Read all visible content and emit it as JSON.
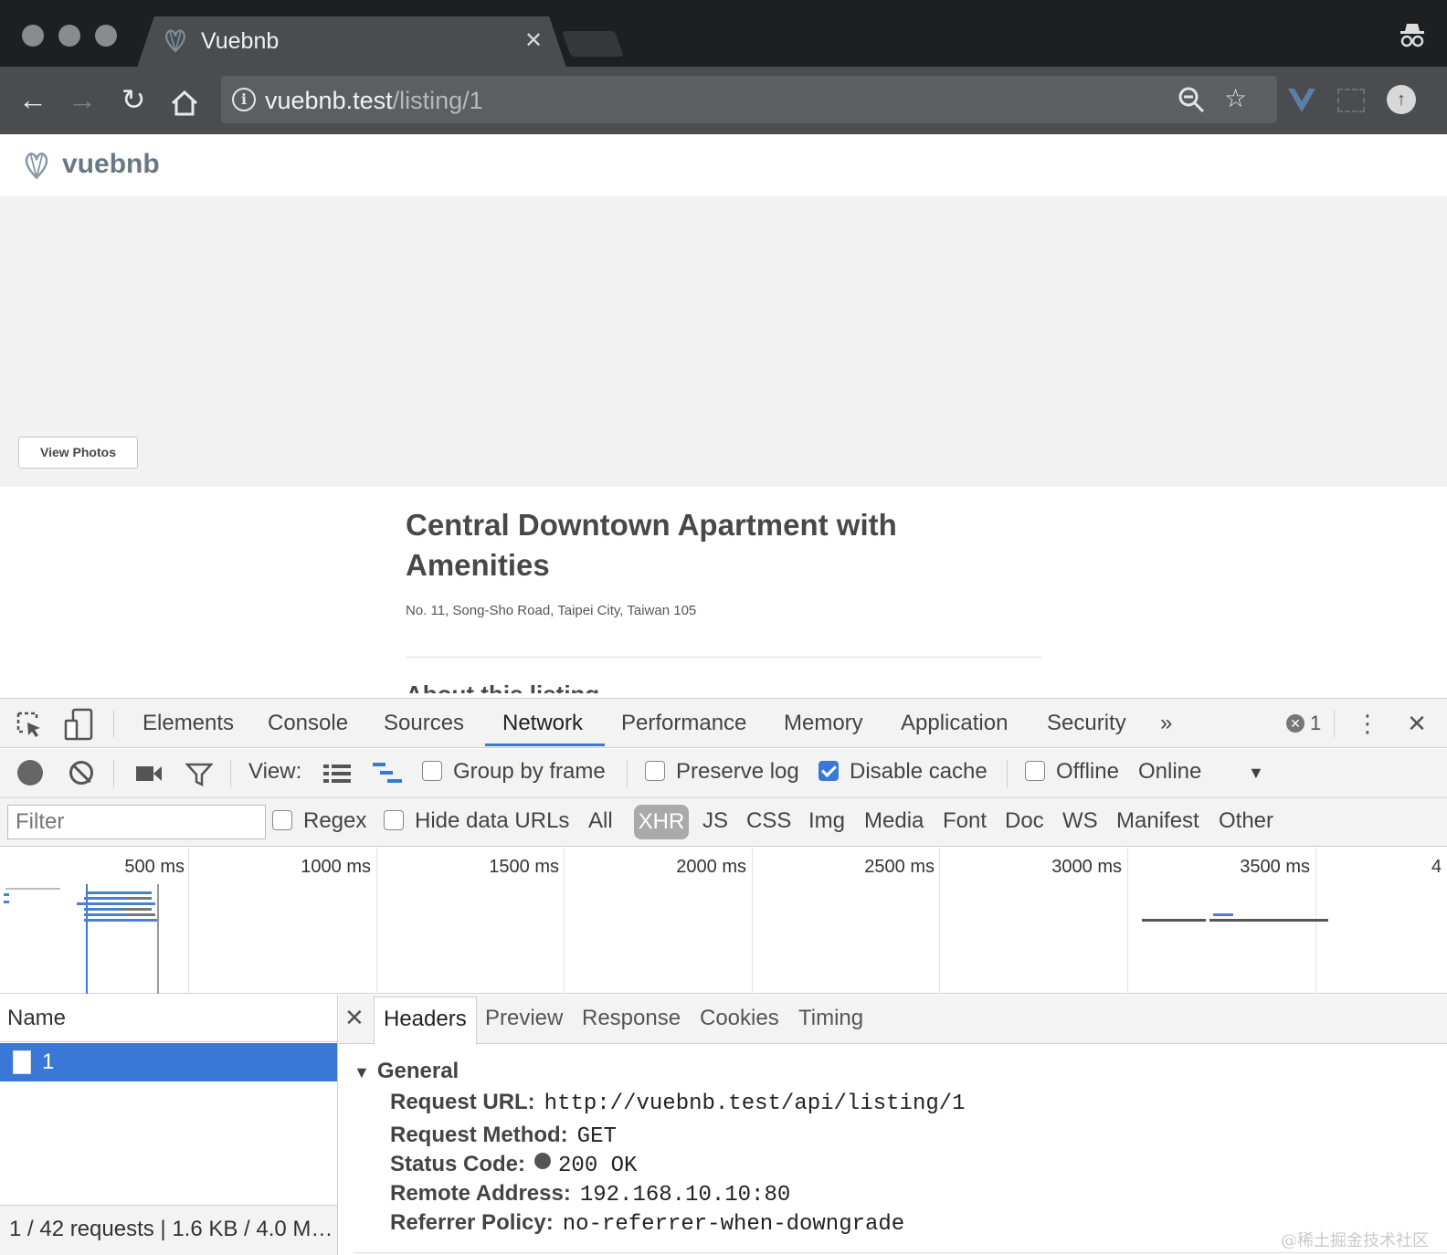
{
  "browser": {
    "tab_title": "Vuebnb",
    "url_host": "vuebnb.test",
    "url_path": "/listing/1"
  },
  "site": {
    "brand": "vuebnb",
    "view_photos": "View Photos",
    "listing_title": "Central Downtown Apartment with Amenities",
    "listing_address": "No. 11, Song-Sho Road, Taipei City, Taiwan 105",
    "listing_subheading": "About this listing"
  },
  "devtools": {
    "tabs": [
      "Elements",
      "Console",
      "Sources",
      "Network",
      "Performance",
      "Memory",
      "Application",
      "Security"
    ],
    "active_tab": "Network",
    "more_tabs": "»",
    "error_count": "1",
    "controls": {
      "view_label": "View:",
      "group_by_frame": "Group by frame",
      "preserve_log": "Preserve log",
      "disable_cache": "Disable cache",
      "offline": "Offline",
      "throttle": "Online"
    },
    "filter": {
      "placeholder": "Filter",
      "regex": "Regex",
      "hide_data_urls": "Hide data URLs",
      "types": [
        "All",
        "XHR",
        "JS",
        "CSS",
        "Img",
        "Media",
        "Font",
        "Doc",
        "WS",
        "Manifest",
        "Other"
      ],
      "active_type": "XHR"
    },
    "timeline_ticks": [
      "500 ms",
      "1000 ms",
      "1500 ms",
      "2000 ms",
      "2500 ms",
      "3000 ms",
      "3500 ms",
      "4"
    ],
    "name_header": "Name",
    "requests": [
      {
        "name": "1",
        "selected": true
      }
    ],
    "summary": "1 / 42 requests | 1.6 KB / 4.0 M…",
    "detail_tabs": [
      "Headers",
      "Preview",
      "Response",
      "Cookies",
      "Timing"
    ],
    "active_detail_tab": "Headers",
    "general": {
      "title": "General",
      "request_url_label": "Request URL:",
      "request_url": "http://vuebnb.test/api/listing/1",
      "request_method_label": "Request Method:",
      "request_method": "GET",
      "status_code_label": "Status Code:",
      "status_code": "200 OK",
      "remote_address_label": "Remote Address:",
      "remote_address": "192.168.10.10:80",
      "referrer_policy_label": "Referrer Policy:",
      "referrer_policy": "no-referrer-when-downgrade"
    }
  },
  "watermark": "@稀土掘金技术社区",
  "colors": {
    "accent": "#3a78d8",
    "chrome_dark": "#1e1f21",
    "chrome_toolbar": "#4a4c4f"
  }
}
